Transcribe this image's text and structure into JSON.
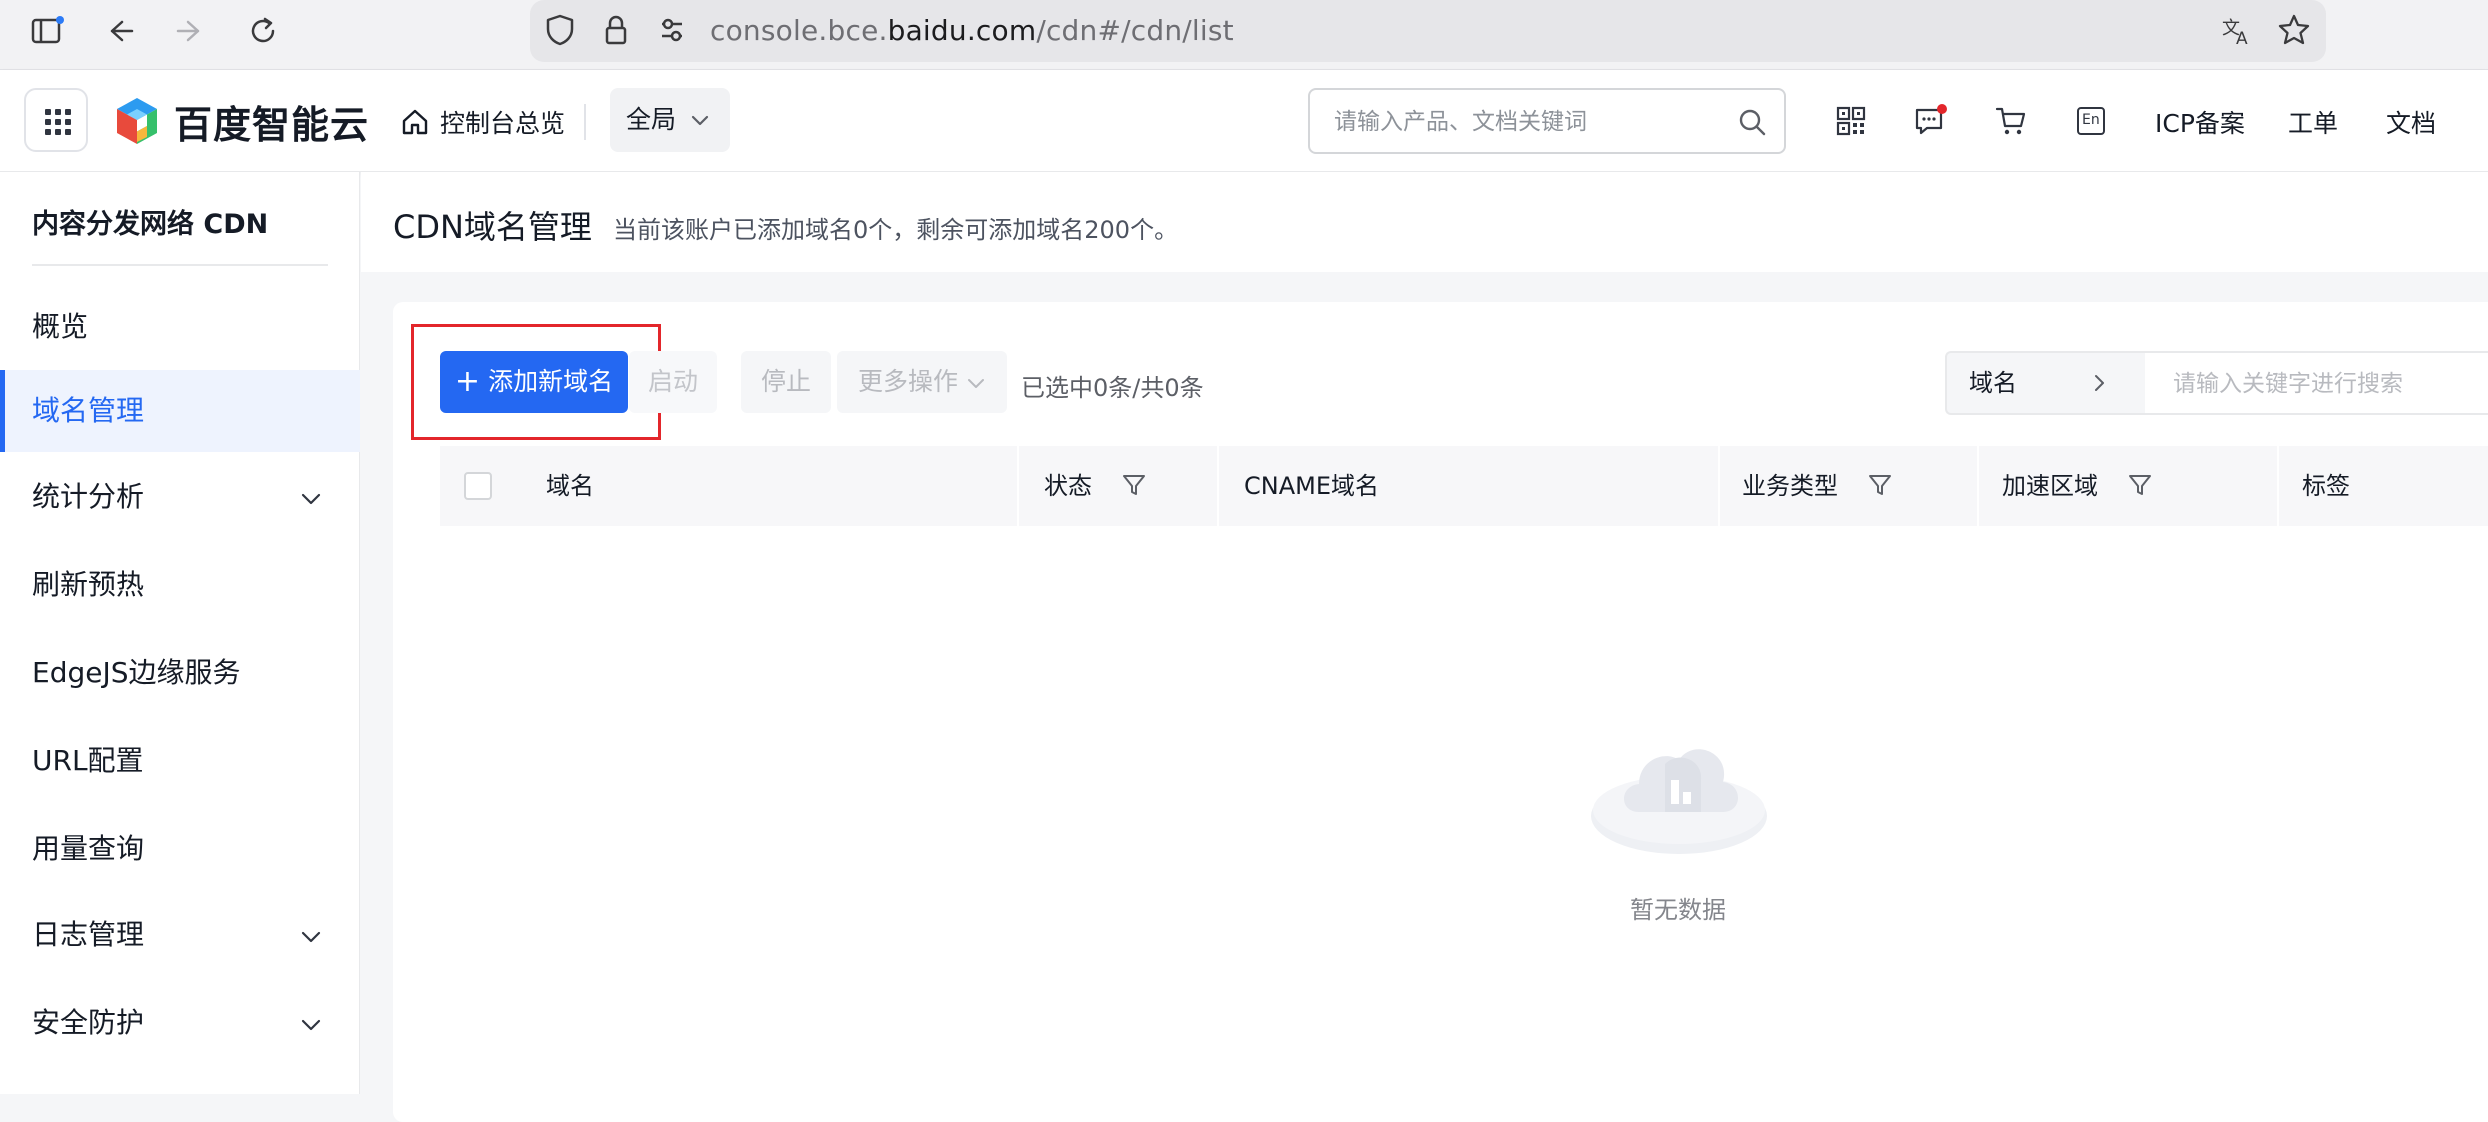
{
  "browser": {
    "url_prefix": "console.bce.",
    "url_domain": "baidu.com",
    "url_path": "/cdn#/cdn/list"
  },
  "topnav": {
    "brand": "百度智能云",
    "home_label": "控制台总览",
    "region_label": "全局",
    "search_placeholder": "请输入产品、文档关键词",
    "icp_label": "ICP备案",
    "ticket_label": "工单",
    "docs_label": "文档",
    "lang_badge": "En"
  },
  "sidebar": {
    "title": "内容分发网络 CDN",
    "items": [
      {
        "label": "概览"
      },
      {
        "label": "域名管理"
      },
      {
        "label": "统计分析"
      },
      {
        "label": "刷新预热"
      },
      {
        "label": "EdgeJS边缘服务"
      },
      {
        "label": "URL配置"
      },
      {
        "label": "用量查询"
      },
      {
        "label": "日志管理"
      },
      {
        "label": "安全防护"
      }
    ],
    "active_index": 1
  },
  "page": {
    "title": "CDN域名管理",
    "subtitle": "当前该账户已添加域名0个，剩余可添加域名200个。"
  },
  "toolbar": {
    "add_label": "添加新域名",
    "start_label": "启动",
    "stop_label": "停止",
    "more_label": "更多操作",
    "selection_info": "已选中0条/共0条",
    "filter_field": "域名",
    "filter_placeholder": "请输入关键字进行搜索"
  },
  "table": {
    "columns": [
      "域名",
      "状态",
      "CNAME域名",
      "业务类型",
      "加速区域",
      "标签"
    ],
    "rows": [],
    "empty_text": "暂无数据"
  },
  "colors": {
    "accent": "#2468f2",
    "highlight": "#e3262b"
  }
}
